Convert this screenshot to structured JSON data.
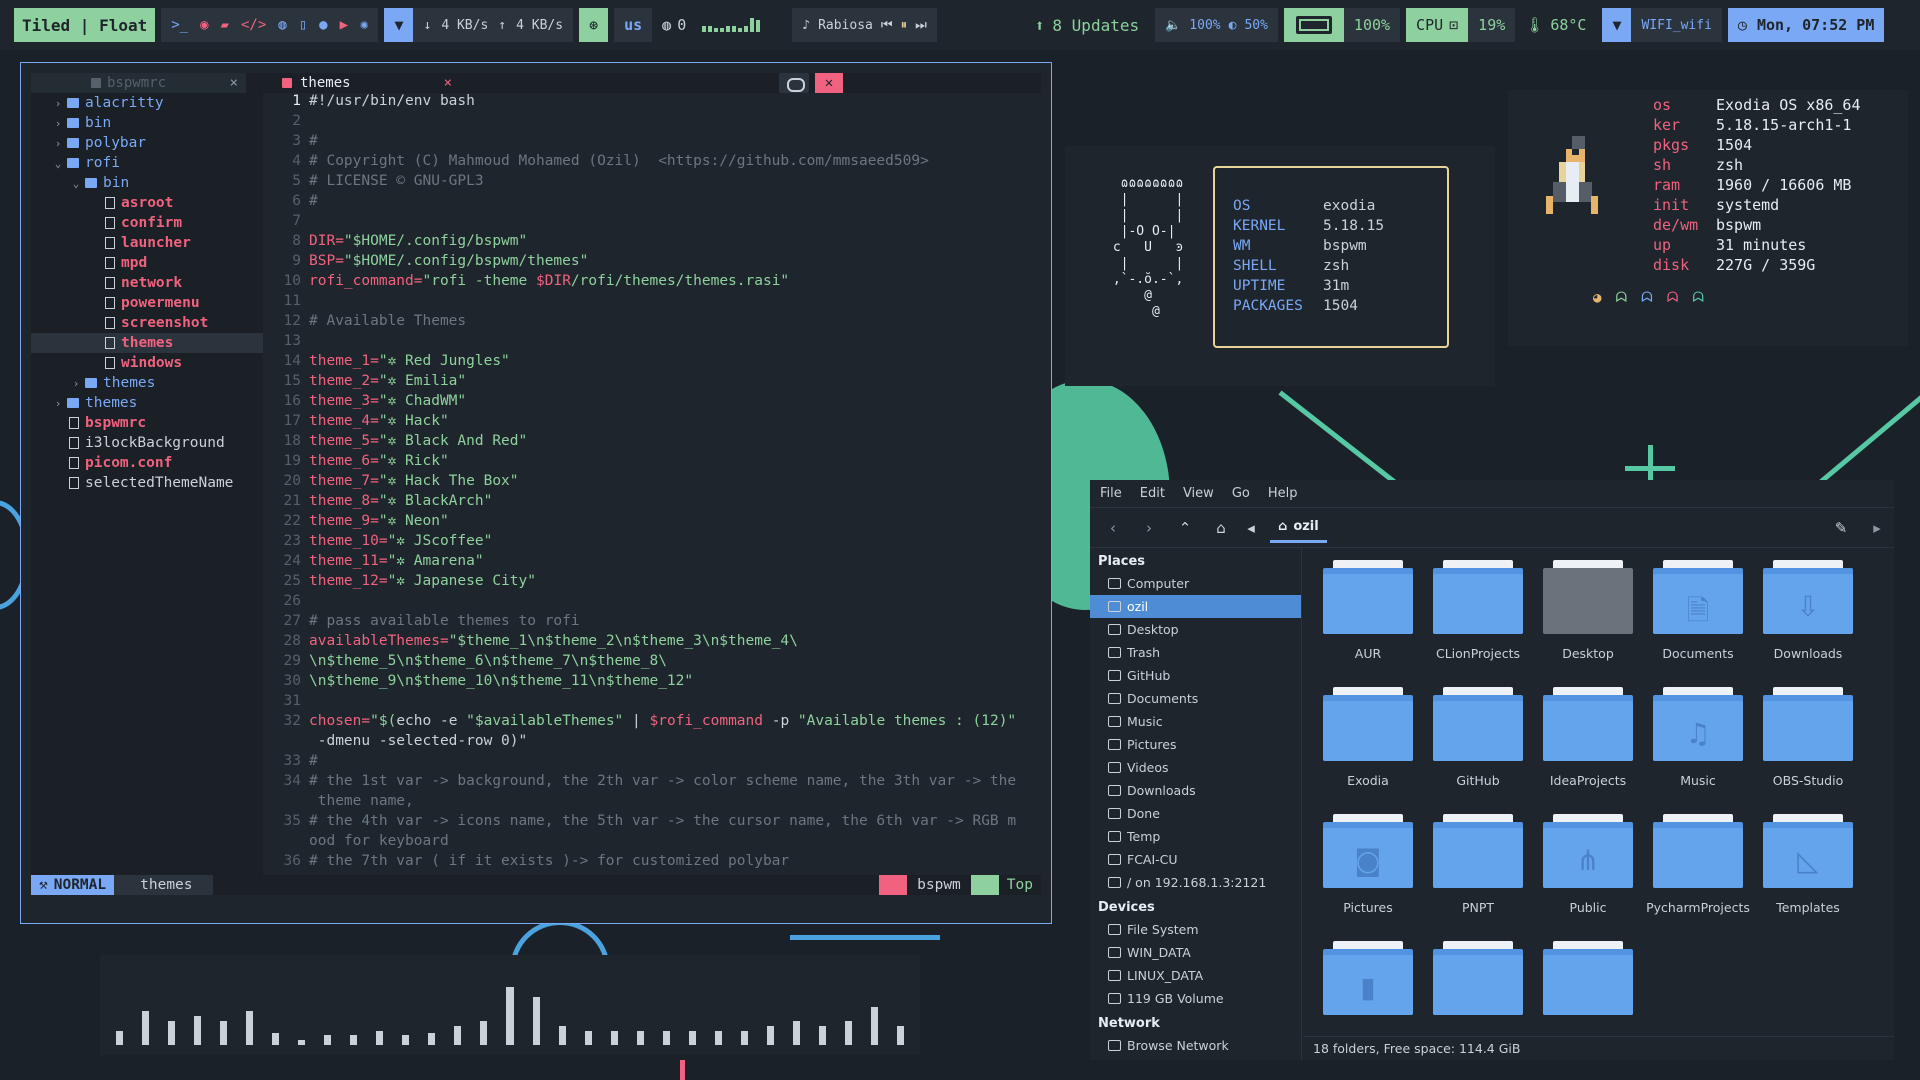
{
  "bar": {
    "layout_mode": "Tiled | Float",
    "net_down": "4 KB/s",
    "net_up": "4 KB/s",
    "kb_layout": "us",
    "gh_count": "0",
    "music_title": "Rabiosa",
    "updates": "8 Updates",
    "volume": "100%",
    "brightness": "50%",
    "battery": "100%",
    "cpu_label": "CPU",
    "cpu": "19%",
    "temp": "68°C",
    "wifi": "WIFI_wifi",
    "clock": "Mon, 07:52 PM"
  },
  "editor": {
    "tab_inactive": "bspwmrc",
    "tab_active": "themes",
    "tree": [
      {
        "depth": 0,
        "chev": "›",
        "type": "dir",
        "label": "alacritty"
      },
      {
        "depth": 0,
        "chev": "›",
        "type": "dir",
        "label": "bin"
      },
      {
        "depth": 0,
        "chev": "›",
        "type": "dir",
        "label": "polybar"
      },
      {
        "depth": 0,
        "chev": "⌄",
        "type": "dir",
        "label": "rofi"
      },
      {
        "depth": 1,
        "chev": "⌄",
        "type": "dir",
        "label": "bin"
      },
      {
        "depth": 2,
        "chev": "",
        "type": "exec",
        "label": "asroot"
      },
      {
        "depth": 2,
        "chev": "",
        "type": "exec",
        "label": "confirm"
      },
      {
        "depth": 2,
        "chev": "",
        "type": "exec",
        "label": "launcher"
      },
      {
        "depth": 2,
        "chev": "",
        "type": "exec",
        "label": "mpd"
      },
      {
        "depth": 2,
        "chev": "",
        "type": "exec",
        "label": "network"
      },
      {
        "depth": 2,
        "chev": "",
        "type": "exec",
        "label": "powermenu"
      },
      {
        "depth": 2,
        "chev": "",
        "type": "exec",
        "label": "screenshot"
      },
      {
        "depth": 2,
        "chev": "",
        "type": "exec",
        "label": "themes",
        "selected": true
      },
      {
        "depth": 2,
        "chev": "",
        "type": "exec",
        "label": "windows"
      },
      {
        "depth": 1,
        "chev": "›",
        "type": "dir",
        "label": "themes"
      },
      {
        "depth": 0,
        "chev": "›",
        "type": "dir",
        "label": "themes"
      },
      {
        "depth": 0,
        "chev": "",
        "type": "exec",
        "label": "bspwmrc"
      },
      {
        "depth": 0,
        "chev": "",
        "type": "plain",
        "label": "i3lockBackground"
      },
      {
        "depth": 0,
        "chev": "",
        "type": "exec",
        "label": "picom.conf"
      },
      {
        "depth": 0,
        "chev": "",
        "type": "plain",
        "label": "selectedThemeName"
      }
    ],
    "code": [
      {
        "n": "1",
        "parts": [
          [
            "cc",
            "#!/usr/bin/env bash"
          ]
        ],
        "cur": true
      },
      {
        "n": "2",
        "parts": []
      },
      {
        "n": "3",
        "parts": [
          [
            "cmt",
            "#"
          ]
        ]
      },
      {
        "n": "4",
        "parts": [
          [
            "cmt",
            "# Copyright (C) Mahmoud Mohamed (Ozil)  <https://github.com/mmsaeed509>"
          ]
        ]
      },
      {
        "n": "5",
        "parts": [
          [
            "cmt",
            "# LICENSE © GNU-GPL3"
          ]
        ]
      },
      {
        "n": "6",
        "parts": [
          [
            "cmt",
            "#"
          ]
        ]
      },
      {
        "n": "7",
        "parts": []
      },
      {
        "n": "8",
        "parts": [
          [
            "var",
            "DIR="
          ],
          [
            "str",
            "\"$HOME/.config/bspwm\""
          ]
        ]
      },
      {
        "n": "9",
        "parts": [
          [
            "var",
            "BSP="
          ],
          [
            "str",
            "\"$HOME/.config/bspwm/themes\""
          ]
        ]
      },
      {
        "n": "10",
        "parts": [
          [
            "var",
            "rofi_command="
          ],
          [
            "str",
            "\"rofi -theme "
          ],
          [
            "var",
            "$DIR"
          ],
          [
            "str",
            "/rofi/themes/themes.rasi\""
          ]
        ]
      },
      {
        "n": "11",
        "parts": []
      },
      {
        "n": "12",
        "parts": [
          [
            "cmt",
            "# Available Themes"
          ]
        ]
      },
      {
        "n": "13",
        "parts": []
      },
      {
        "n": "14",
        "parts": [
          [
            "var",
            "theme_1="
          ],
          [
            "str",
            "\"✲ Red Jungles\""
          ]
        ]
      },
      {
        "n": "15",
        "parts": [
          [
            "var",
            "theme_2="
          ],
          [
            "str",
            "\"✲ Emilia\""
          ]
        ]
      },
      {
        "n": "16",
        "parts": [
          [
            "var",
            "theme_3="
          ],
          [
            "str",
            "\"✲ ChadWM\""
          ]
        ]
      },
      {
        "n": "17",
        "parts": [
          [
            "var",
            "theme_4="
          ],
          [
            "str",
            "\"✲ Hack\""
          ]
        ]
      },
      {
        "n": "18",
        "parts": [
          [
            "var",
            "theme_5="
          ],
          [
            "str",
            "\"✲ Black And Red\""
          ]
        ]
      },
      {
        "n": "19",
        "parts": [
          [
            "var",
            "theme_6="
          ],
          [
            "str",
            "\"✲ Rick\""
          ]
        ]
      },
      {
        "n": "20",
        "parts": [
          [
            "var",
            "theme_7="
          ],
          [
            "str",
            "\"✲ Hack The Box\""
          ]
        ]
      },
      {
        "n": "21",
        "parts": [
          [
            "var",
            "theme_8="
          ],
          [
            "str",
            "\"✲ BlackArch\""
          ]
        ]
      },
      {
        "n": "22",
        "parts": [
          [
            "var",
            "theme_9="
          ],
          [
            "str",
            "\"✲ Neon\""
          ]
        ]
      },
      {
        "n": "23",
        "parts": [
          [
            "var",
            "theme_10="
          ],
          [
            "str",
            "\"✲ JScoffee\""
          ]
        ]
      },
      {
        "n": "24",
        "parts": [
          [
            "var",
            "theme_11="
          ],
          [
            "str",
            "\"✲ Amarena\""
          ]
        ]
      },
      {
        "n": "25",
        "parts": [
          [
            "var",
            "theme_12="
          ],
          [
            "str",
            "\"✲ Japanese City\""
          ]
        ]
      },
      {
        "n": "26",
        "parts": []
      },
      {
        "n": "27",
        "parts": [
          [
            "cmt",
            "# pass available themes to rofi"
          ]
        ]
      },
      {
        "n": "28",
        "parts": [
          [
            "var",
            "availableThemes="
          ],
          [
            "str",
            "\"$theme_1\\n$theme_2\\n$theme_3\\n$theme_4\\"
          ]
        ]
      },
      {
        "n": "29",
        "parts": [
          [
            "str",
            "\\n$theme_5\\n$theme_6\\n$theme_7\\n$theme_8\\"
          ]
        ]
      },
      {
        "n": "30",
        "parts": [
          [
            "str",
            "\\n$theme_9\\n$theme_10\\n$theme_11\\n$theme_12\""
          ]
        ]
      },
      {
        "n": "31",
        "parts": []
      },
      {
        "n": "32",
        "parts": [
          [
            "var",
            "chosen="
          ],
          [
            "str",
            "\"$("
          ],
          [
            "plain",
            "echo -e "
          ],
          [
            "str",
            "\"$availableThemes\""
          ],
          [
            "plain",
            " | "
          ],
          [
            "var",
            "$rofi_command"
          ],
          [
            "plain",
            " -p "
          ],
          [
            "str",
            "\"Available themes : (12)\""
          ]
        ]
      },
      {
        "n": "",
        "parts": [
          [
            "plain",
            " -dmenu -selected-row 0)\""
          ]
        ]
      },
      {
        "n": "33",
        "parts": [
          [
            "cmt",
            "#"
          ]
        ]
      },
      {
        "n": "34",
        "parts": [
          [
            "cmt",
            "# the 1st var -> background, the 2th var -> color scheme name, the 3th var -> the"
          ]
        ]
      },
      {
        "n": "",
        "parts": [
          [
            "cmt",
            " theme name,"
          ]
        ]
      },
      {
        "n": "35",
        "parts": [
          [
            "cmt",
            "# the 4th var -> icons name, the 5th var -> the cursor name, the 6th var -> RGB m"
          ]
        ]
      },
      {
        "n": "",
        "parts": [
          [
            "cmt",
            "ood for keyboard"
          ]
        ]
      },
      {
        "n": "36",
        "parts": [
          [
            "cmt",
            "# the 7th var ( if it exists )-> for customized polybar"
          ]
        ]
      }
    ],
    "status_mode": "NORMAL",
    "status_file": "themes",
    "status_dir": "bspwm",
    "status_pos": "Top"
  },
  "neofetch": {
    "ascii": "  ɷɷɷɷɷɷɷɷ\n  |      |\n  |      |\n  |-O O-|\n ϲ   U   ͽ\n  |      |\n ,`-.ŏ.-`,\n     @\n      @",
    "rows": [
      {
        "k": "OS",
        "v": "exodia"
      },
      {
        "k": "KERNEL",
        "v": "5.18.15"
      },
      {
        "k": "WM",
        "v": "bspwm"
      },
      {
        "k": "SHELL",
        "v": "zsh"
      },
      {
        "k": "UPTIME",
        "v": "31m"
      },
      {
        "k": "PACKAGES",
        "v": "1504"
      }
    ]
  },
  "sysinfo": {
    "rows": [
      {
        "k": "os",
        "v": "Exodia OS x86_64"
      },
      {
        "k": "ker",
        "v": "5.18.15-arch1-1"
      },
      {
        "k": "pkgs",
        "v": "1504"
      },
      {
        "k": "sh",
        "v": "zsh"
      },
      {
        "k": "ram",
        "v": "1960 / 16606 MB"
      },
      {
        "k": "init",
        "v": "systemd"
      },
      {
        "k": "de/wm",
        "v": "bspwm"
      },
      {
        "k": "up",
        "v": "31 minutes"
      },
      {
        "k": "disk",
        "v": "227G / 359G"
      }
    ]
  },
  "filemanager": {
    "menu": [
      "File",
      "Edit",
      "View",
      "Go",
      "Help"
    ],
    "path": "ozil",
    "sections": [
      {
        "title": "Places",
        "items": [
          {
            "label": "Computer"
          },
          {
            "label": "ozil",
            "selected": true
          },
          {
            "label": "Desktop"
          },
          {
            "label": "Trash"
          },
          {
            "label": "GitHub"
          },
          {
            "label": "Documents"
          },
          {
            "label": "Music"
          },
          {
            "label": "Pictures"
          },
          {
            "label": "Videos"
          },
          {
            "label": "Downloads"
          },
          {
            "label": "Done"
          },
          {
            "label": "Temp"
          },
          {
            "label": "FCAI-CU"
          },
          {
            "label": "/ on 192.168.1.3:2121"
          }
        ]
      },
      {
        "title": "Devices",
        "items": [
          {
            "label": "File System"
          },
          {
            "label": "WIN_DATA"
          },
          {
            "label": "LINUX_DATA"
          },
          {
            "label": "119 GB Volume"
          }
        ]
      },
      {
        "title": "Network",
        "items": [
          {
            "label": "Browse Network"
          }
        ]
      }
    ],
    "folders": [
      {
        "name": "AUR",
        "glyph": ""
      },
      {
        "name": "CLionProjects",
        "glyph": ""
      },
      {
        "name": "Desktop",
        "glyph": "desk"
      },
      {
        "name": "Documents",
        "glyph": "🗎"
      },
      {
        "name": "Downloads",
        "glyph": "⇩"
      },
      {
        "name": "Exodia",
        "glyph": ""
      },
      {
        "name": "GitHub",
        "glyph": ""
      },
      {
        "name": "IdeaProjects",
        "glyph": ""
      },
      {
        "name": "Music",
        "glyph": "♫"
      },
      {
        "name": "OBS-Studio",
        "glyph": ""
      },
      {
        "name": "Pictures",
        "glyph": "◙"
      },
      {
        "name": "PNPT",
        "glyph": ""
      },
      {
        "name": "Public",
        "glyph": "⋔"
      },
      {
        "name": "PycharmProjects",
        "glyph": ""
      },
      {
        "name": "Templates",
        "glyph": "◺"
      },
      {
        "name": "",
        "glyph": "▮"
      },
      {
        "name": "",
        "glyph": ""
      },
      {
        "name": "",
        "glyph": ""
      }
    ],
    "status": "18 folders, Free space: 114.4 GiB"
  },
  "visualizer": [
    6,
    14,
    10,
    12,
    10,
    14,
    5,
    2,
    4,
    4,
    6,
    4,
    5,
    8,
    10,
    24,
    20,
    8,
    6,
    6,
    6,
    6,
    6,
    6,
    6,
    8,
    10,
    8,
    10,
    16,
    8
  ]
}
